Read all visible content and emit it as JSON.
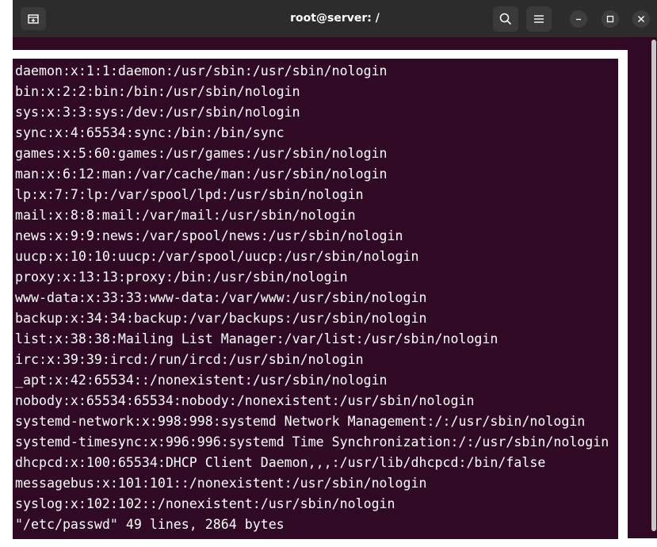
{
  "window": {
    "title": "root@server: /"
  },
  "icons": {
    "new_tab": "new-tab-icon",
    "search": "search-icon",
    "menu": "hamburger-menu-icon",
    "minimize": "minimize-icon",
    "maximize": "maximize-icon",
    "close": "close-icon"
  },
  "colors": {
    "titlebar": "#2c2c2c",
    "terminal_bg": "#300a24",
    "text": "#ffffff"
  },
  "terminal": {
    "lines": [
      "daemon:x:1:1:daemon:/usr/sbin:/usr/sbin/nologin",
      "bin:x:2:2:bin:/bin:/usr/sbin/nologin",
      "sys:x:3:3:sys:/dev:/usr/sbin/nologin",
      "sync:x:4:65534:sync:/bin:/bin/sync",
      "games:x:5:60:games:/usr/games:/usr/sbin/nologin",
      "man:x:6:12:man:/var/cache/man:/usr/sbin/nologin",
      "lp:x:7:7:lp:/var/spool/lpd:/usr/sbin/nologin",
      "mail:x:8:8:mail:/var/mail:/usr/sbin/nologin",
      "news:x:9:9:news:/var/spool/news:/usr/sbin/nologin",
      "uucp:x:10:10:uucp:/var/spool/uucp:/usr/sbin/nologin",
      "proxy:x:13:13:proxy:/bin:/usr/sbin/nologin",
      "www-data:x:33:33:www-data:/var/www:/usr/sbin/nologin",
      "backup:x:34:34:backup:/var/backups:/usr/sbin/nologin",
      "list:x:38:38:Mailing List Manager:/var/list:/usr/sbin/nologin",
      "irc:x:39:39:ircd:/run/ircd:/usr/sbin/nologin",
      "_apt:x:42:65534::/nonexistent:/usr/sbin/nologin",
      "nobody:x:65534:65534:nobody:/nonexistent:/usr/sbin/nologin",
      "systemd-network:x:998:998:systemd Network Management:/:/usr/sbin/nologin",
      "systemd-timesync:x:996:996:systemd Time Synchronization:/:/usr/sbin/nologin",
      "dhcpcd:x:100:65534:DHCP Client Daemon,,,:/usr/lib/dhcpcd:/bin/false",
      "messagebus:x:101:101::/nonexistent:/usr/sbin/nologin",
      "syslog:x:102:102::/nonexistent:/usr/sbin/nologin"
    ],
    "status": "\"/etc/passwd\" 49 lines, 2864 bytes"
  }
}
